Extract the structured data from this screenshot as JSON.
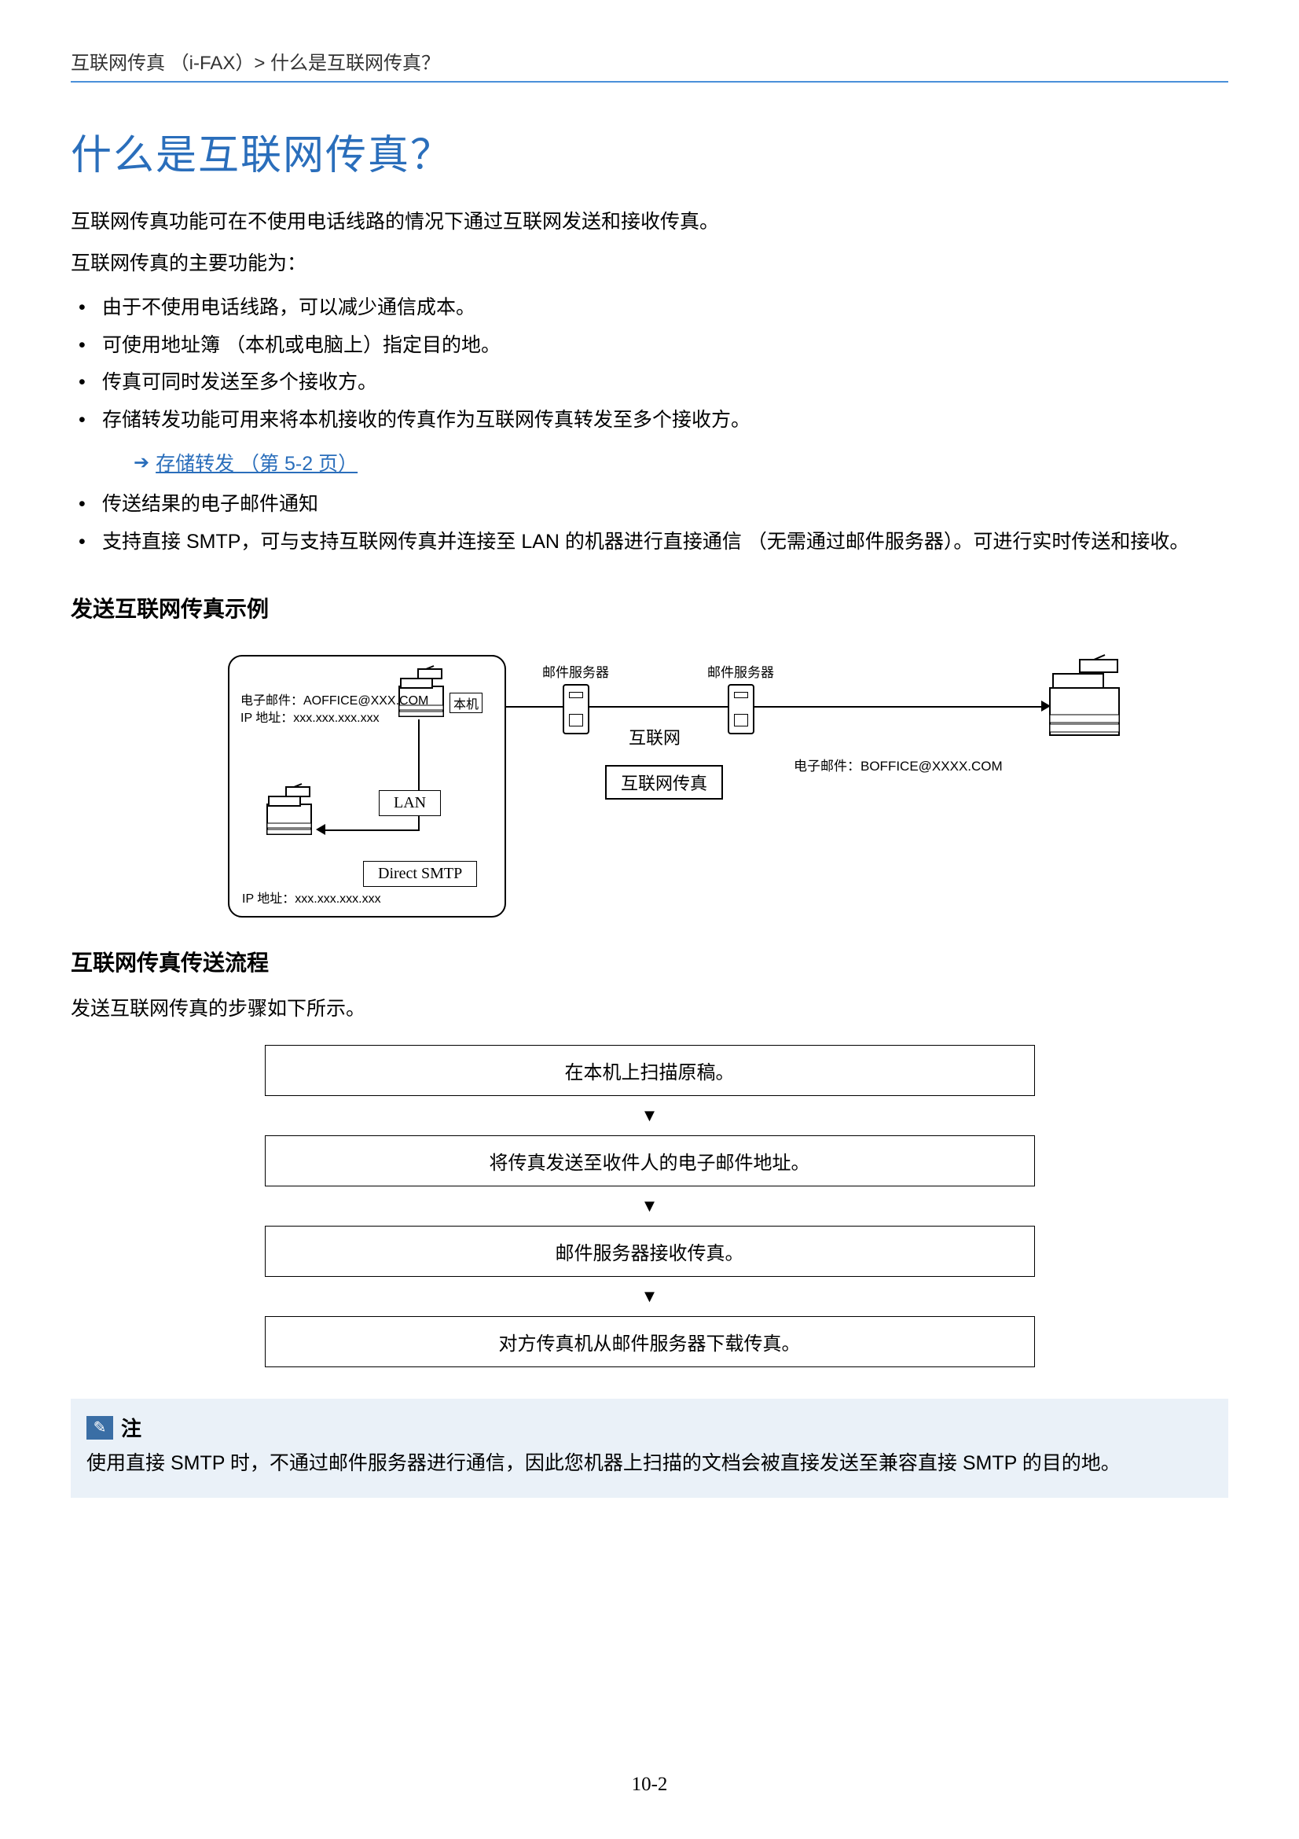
{
  "breadcrumb": "互联网传真 （i-FAX）> 什么是互联网传真？",
  "title": "什么是互联网传真？",
  "intro1": "互联网传真功能可在不使用电话线路的情况下通过互联网发送和接收传真。",
  "intro2": "互联网传真的主要功能为：",
  "features": [
    "由于不使用电话线路，可以减少通信成本。",
    "可使用地址簿 （本机或电脑上）指定目的地。",
    "传真可同时发送至多个接收方。",
    "存储转发功能可用来将本机接收的传真作为互联网传真转发至多个接收方。"
  ],
  "link_label": "存储转发 （第 5-2 页）",
  "features2": [
    "传送结果的电子邮件通知",
    "支持直接 SMTP，可与支持互联网传真并连接至 LAN 的机器进行直接通信 （无需通过邮件服务器）。可进行实时传送和接收。"
  ],
  "section1_heading": "发送互联网传真示例",
  "diagram": {
    "left_email": "电子邮件：AOFFICE@XXX.COM",
    "left_ip": "IP 地址：xxx.xxx.xxx.xxx",
    "machine_tag": "本机",
    "bottom_ip": "IP 地址：xxx.xxx.xxx.xxx",
    "lan": "LAN",
    "direct_smtp": "Direct SMTP",
    "mail_server": "邮件服务器",
    "internet": "互联网",
    "ifax_box": "互联网传真",
    "right_email": "电子邮件：BOFFICE@XXXX.COM"
  },
  "section2_heading": "互联网传真传送流程",
  "section2_text": "发送互联网传真的步骤如下所示。",
  "flow": [
    "在本机上扫描原稿。",
    "将传真发送至收件人的电子邮件地址。",
    "邮件服务器接收传真。",
    "对方传真机从邮件服务器下载传真。"
  ],
  "note_title": "注",
  "note_body": "使用直接 SMTP 时，不通过邮件服务器进行通信，因此您机器上扫描的文档会被直接发送至兼容直接 SMTP 的目的地。",
  "page_number": "10-2"
}
